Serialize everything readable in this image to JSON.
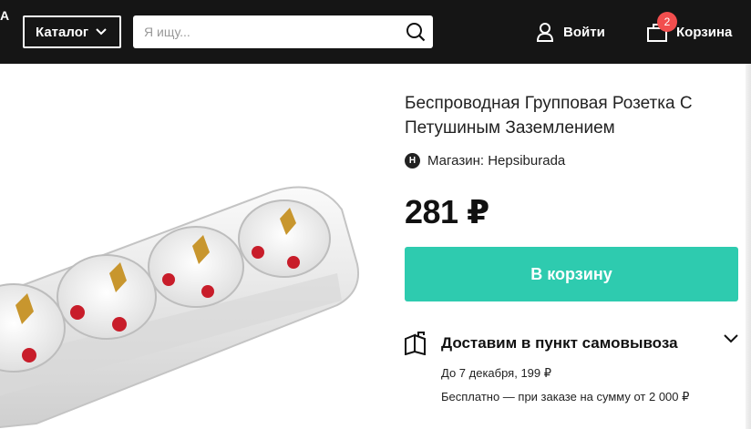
{
  "header": {
    "logo_fragment": "A",
    "catalog_label": "Каталог",
    "search_placeholder": "Я ищу...",
    "login_label": "Войти",
    "cart_label": "Корзина",
    "cart_count": "2"
  },
  "product": {
    "title": "Беспроводная Групповая Розетка С Петушиным Заземлением",
    "shop_icon_letter": "H",
    "shop_label": "Магазин: Hepsiburada",
    "price": "281 ₽",
    "buy_label": "В корзину"
  },
  "delivery": {
    "title": "Доставим в пункт самовывоза",
    "line1": "До 7 декабря, 199 ₽",
    "line2": "Бесплатно — при заказе на сумму от 2 000 ₽"
  },
  "colors": {
    "topbar": "#151515",
    "accent": "#2ecbaf",
    "badge": "#f24e4e"
  }
}
